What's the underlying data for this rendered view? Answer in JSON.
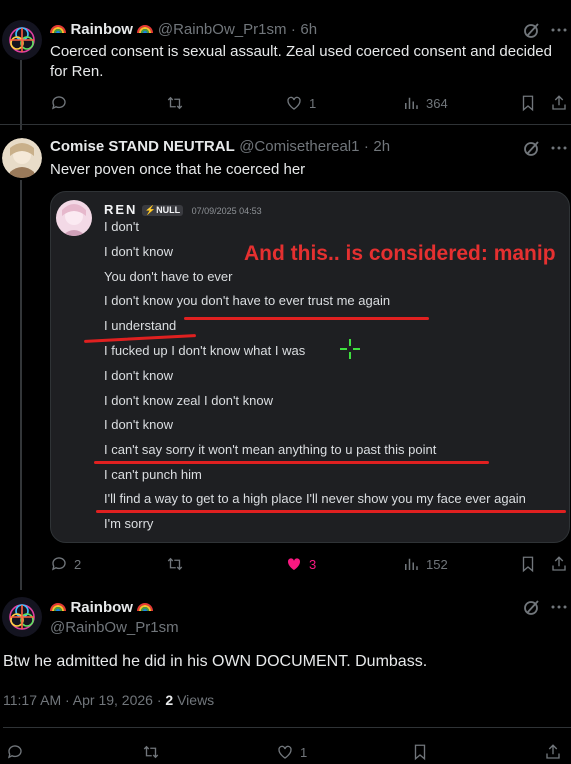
{
  "tweet1": {
    "name": "Rainbow",
    "handle": "@RainbOw_Pr1sm",
    "time": "6h",
    "text": "Coerced consent is sexual assault. Zeal used coerced consent and decided for Ren.",
    "likes": "1",
    "views": "364"
  },
  "tweet2": {
    "name": "Comise STAND NEUTRAL",
    "handle": "@Comisethereal1",
    "time": "2h",
    "text": "Never poven once that he coerced her",
    "replies": "2",
    "likes": "3",
    "views": "152",
    "embed": {
      "username": "REN",
      "badge": "NULL",
      "timestamp": "07/09/2025 04:53",
      "overlay": "And this.. is considered: manip",
      "lines": [
        "I don't",
        "I don't know",
        "You don't have to ever",
        "I don't know you don't have to ever trust me again",
        "I understand",
        "I fucked up I don't know what I was",
        "I don't know",
        "I don't know zeal I don't know",
        "I don't know",
        "I can't say sorry it won't mean anything to u past this point",
        "I can't punch him",
        "I'll find a way to get to a high place I'll never show you my face ever again",
        "I'm sorry"
      ]
    }
  },
  "tweet3": {
    "name": "Rainbow",
    "handle": "@RainbOw_Pr1sm",
    "text": "Btw he admitted he did in his OWN DOCUMENT. Dumbass.",
    "datetime": "11:17 AM · Apr 19, 2026 · ",
    "views_count": "2",
    "views_label": "Views",
    "likes": "1"
  },
  "colors": {
    "background": "#000000",
    "text": "#e7e9ea",
    "muted": "#71767b",
    "liked": "#f91880",
    "underline": "#e02020"
  },
  "icons": [
    "grok-icon",
    "reply-icon",
    "retweet-icon",
    "like-icon",
    "views-icon",
    "bookmark-icon",
    "share-icon"
  ]
}
